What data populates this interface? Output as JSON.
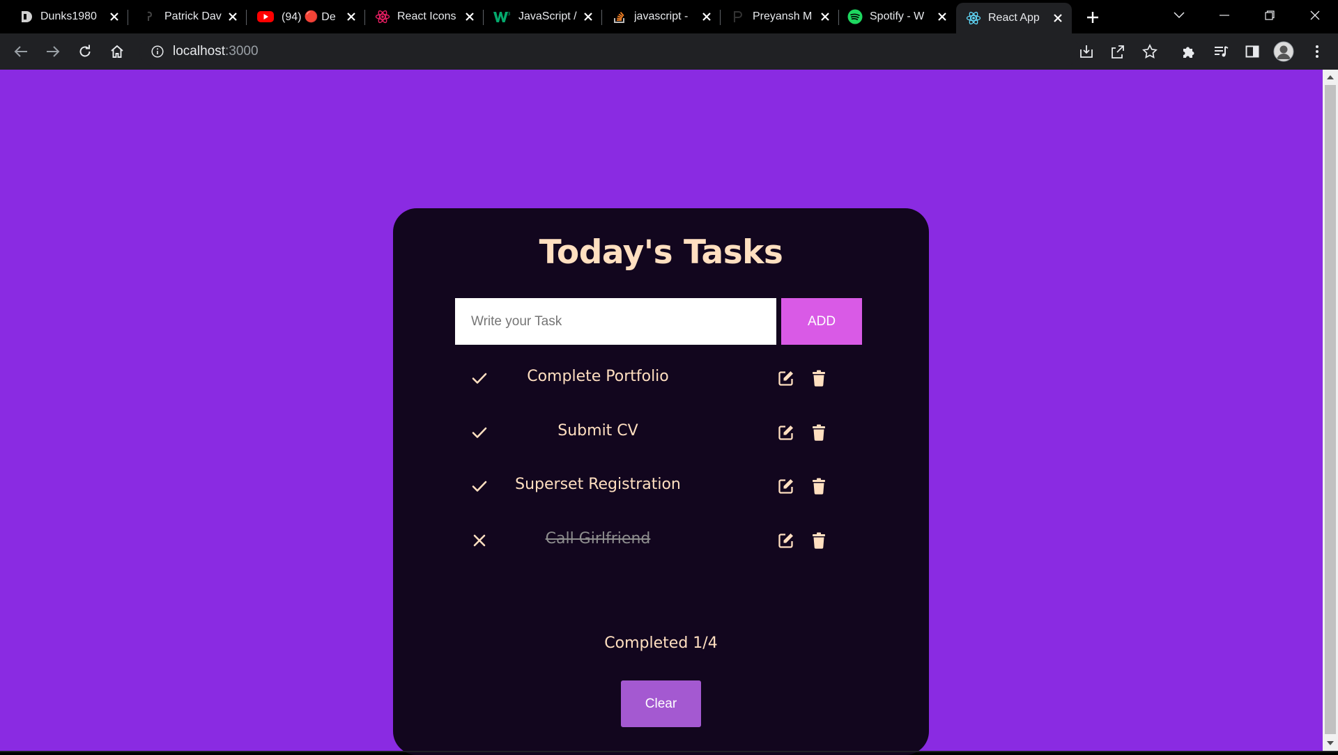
{
  "browser": {
    "tabs": [
      {
        "title": "Dunks1980",
        "icon": "dunks-favicon",
        "active": false
      },
      {
        "title": "Patrick Dav",
        "icon": "patrick-favicon",
        "active": false
      },
      {
        "title": "(94) 🔴 De",
        "icon": "youtube-favicon",
        "active": false
      },
      {
        "title": "React Icons",
        "icon": "react-icons-favicon",
        "active": false
      },
      {
        "title": "JavaScript /",
        "icon": "w3schools-favicon",
        "active": false
      },
      {
        "title": "javascript -",
        "icon": "stackoverflow-favicon",
        "active": false
      },
      {
        "title": "Preyansh M",
        "icon": "preyansh-favicon",
        "active": false
      },
      {
        "title": "Spotify - W",
        "icon": "spotify-favicon",
        "active": false
      },
      {
        "title": "React App",
        "icon": "react-favicon",
        "active": true
      }
    ],
    "url_host": "localhost",
    "url_port": ":3000"
  },
  "app": {
    "title": "Today's Tasks",
    "input_placeholder": "Write your Task",
    "add_label": "ADD",
    "tasks": [
      {
        "text": "Complete Portfolio",
        "done": false
      },
      {
        "text": "Submit CV",
        "done": false
      },
      {
        "text": "Superset Registration",
        "done": false
      },
      {
        "text": "Call Girlfriend",
        "done": true
      }
    ],
    "completed_text": "Completed 1/4",
    "clear_label": "Clear"
  },
  "colors": {
    "page_bg": "#8a2be2",
    "card_bg": "#12061e",
    "accent_text": "#ffdfc0",
    "add_button": "#d95ae6",
    "clear_button": "#a459d1"
  }
}
